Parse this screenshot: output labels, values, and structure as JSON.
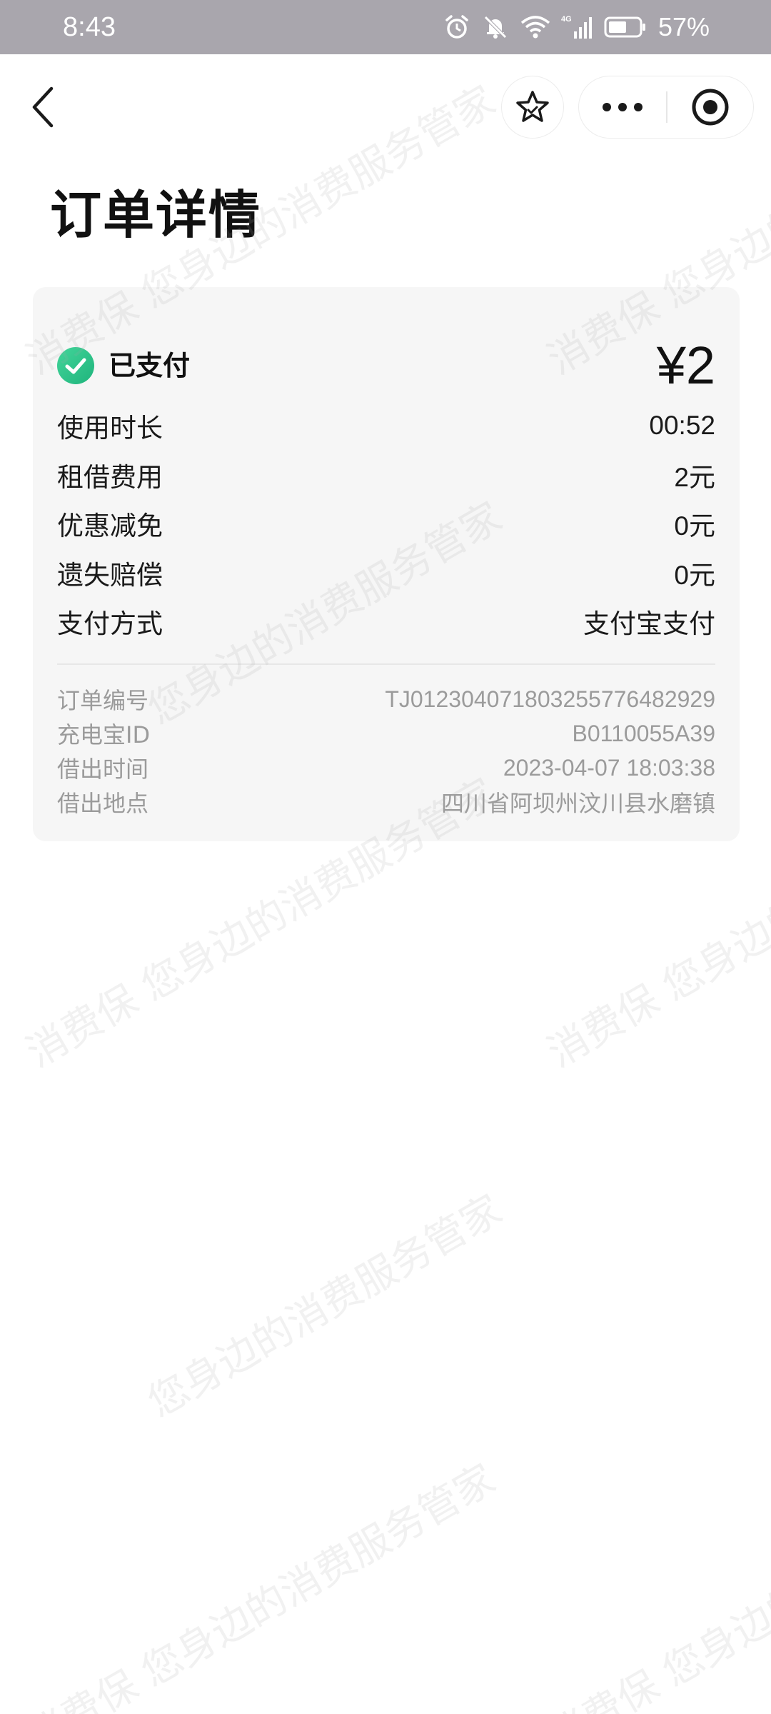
{
  "status_bar": {
    "time": "8:43",
    "battery_percent": "57%",
    "network_label": "4G",
    "icons": [
      "alarm-icon",
      "mute-bell-icon",
      "wifi-icon",
      "cellular-signal-icon",
      "battery-icon"
    ]
  },
  "nav": {
    "back_icon": "back-chevron-icon",
    "favorite_icon": "star-icon",
    "more_icon": "more-dots-icon",
    "close_icon": "target-circle-icon"
  },
  "page": {
    "title": "订单详情"
  },
  "order": {
    "status_label": "已支付",
    "status_icon": "check-circle-icon",
    "amount": "¥2",
    "accent_color": "#2cc28a",
    "details": [
      {
        "label": "使用时长",
        "value": "00:52"
      },
      {
        "label": "租借费用",
        "value": "2元"
      },
      {
        "label": "优惠减免",
        "value": "0元"
      },
      {
        "label": "遗失赔偿",
        "value": "0元"
      },
      {
        "label": "支付方式",
        "value": "支付宝支付"
      }
    ],
    "meta": [
      {
        "label": "订单编号",
        "value": "TJ01230407180325577648292​9"
      },
      {
        "label": "充电宝ID",
        "value": "B0110055A39"
      },
      {
        "label": "借出时间",
        "value": "2023-04-07 18:03:38"
      },
      {
        "label": "借出地点",
        "value": "四川省阿坝州汶川县水磨镇"
      }
    ]
  },
  "watermark": {
    "text_a": "消费保 您身边的消费服务管家",
    "text_b": "您身边的消费服务管家"
  }
}
